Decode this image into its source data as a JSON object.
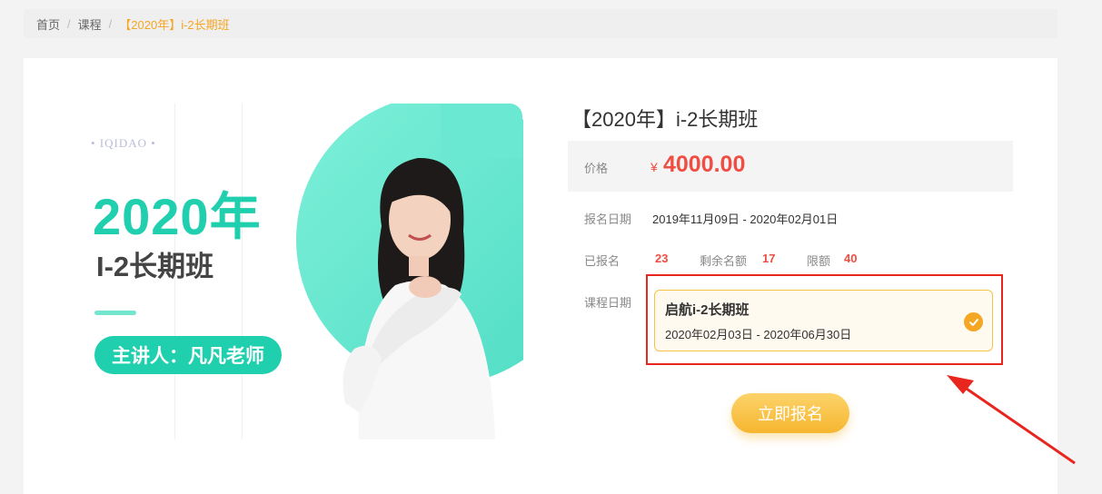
{
  "breadcrumb": {
    "home": "首页",
    "course": "课程",
    "current": "【2020年】i-2长期班",
    "separator": "/"
  },
  "banner": {
    "logo": "• IQIDAO •",
    "year": "2020年",
    "subtitle": "I-2长期班",
    "teacher": "主讲人：凡凡老师"
  },
  "course": {
    "title": "【2020年】i-2长期班",
    "price_label": "价格",
    "currency": "¥",
    "price": "4000.00",
    "signup_label": "报名日期",
    "signup_range": "2019年11月09日 - 2020年02月01日",
    "enrolled_label": "已报名",
    "enrolled": "23",
    "remaining_label": "剩余名额",
    "remaining": "17",
    "limit_label": "限额",
    "limit": "40",
    "course_date_label": "课程日期",
    "option": {
      "name": "启航i-2长期班",
      "range": "2020年02月03日 - 2020年06月30日",
      "selected": true
    },
    "enroll_button": "立即报名"
  },
  "colors": {
    "accent": "#f5a623",
    "price": "#f04d43",
    "teal": "#1fcfae",
    "annotation": "#e8261f"
  }
}
